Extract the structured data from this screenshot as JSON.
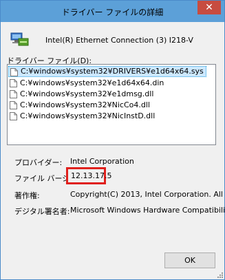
{
  "window": {
    "title": "ドライバー ファイルの詳細",
    "close_glyph": "✕"
  },
  "device": {
    "name": "Intel(R) Ethernet Connection (3) I218-V",
    "icon": "network-adapter-icon"
  },
  "driver_files": {
    "label": "ドライバー ファイル(D):",
    "items": [
      "C:¥windows¥system32¥DRIVERS¥e1d64x64.sys",
      "C:¥windows¥system32¥e1d64x64.din",
      "C:¥windows¥system32¥e1dmsg.dll",
      "C:¥windows¥system32¥NicCo4.dll",
      "C:¥windows¥system32¥NicInstD.dll"
    ],
    "selected_index": 0
  },
  "info": {
    "provider_label": "プロバイダー:",
    "provider_value": "Intel Corporation",
    "version_label": "ファイル バージョン:",
    "version_value": "12.13.17.5",
    "copyright_label": "著作権:",
    "copyright_value": "Copyright(C) 2013, Intel Corporation.  All",
    "signer_label": "デジタル署名者:",
    "signer_value": "Microsoft Windows Hardware Compatibility"
  },
  "buttons": {
    "ok_label": "OK"
  },
  "colors": {
    "titlebar": "#5ca0d8",
    "highlight_box": "#e0201c",
    "selection": "#cce8ff"
  }
}
